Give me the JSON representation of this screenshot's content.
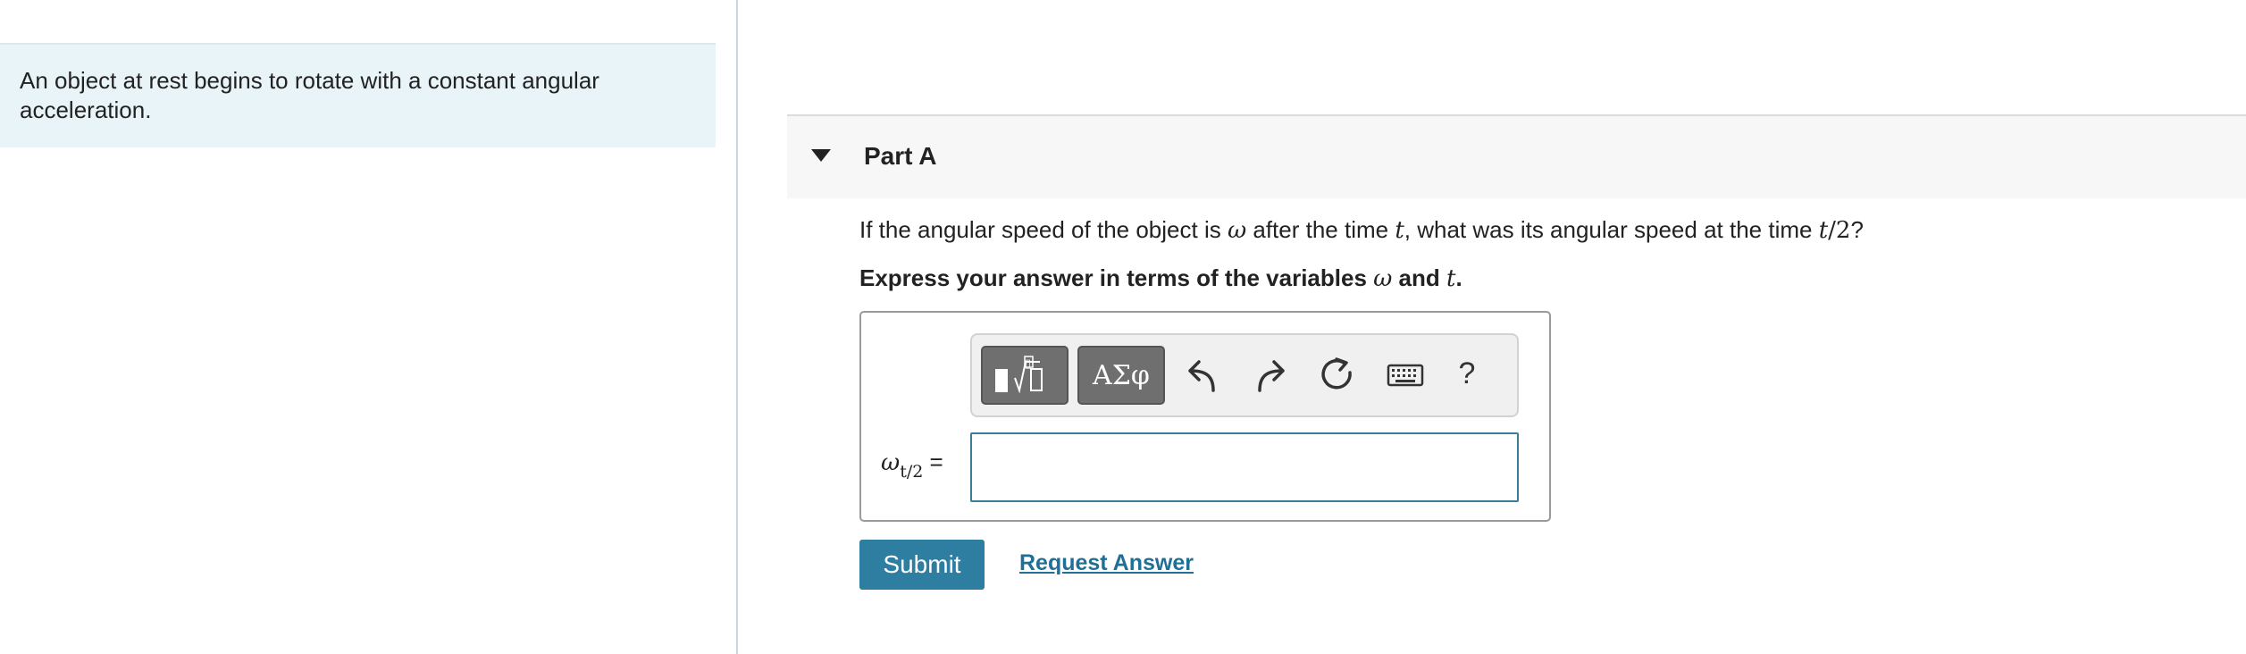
{
  "intro": {
    "text": "An object at rest begins to rotate with a constant angular acceleration."
  },
  "part": {
    "title": "Part A"
  },
  "question": {
    "prefix": "If the angular speed of the object is ",
    "omega": "ω",
    "middle1": " after the time ",
    "t": "t",
    "middle2": ", what was its angular speed at the time ",
    "t2_var": "t",
    "t2_rest": "/2",
    "suffix": "?"
  },
  "instruction": {
    "prefix": "Express your answer in terms of the variables ",
    "omega": "ω",
    "and": " and ",
    "t": "t",
    "suffix": "."
  },
  "toolbar": {
    "templates_icon": "templates-icon",
    "symbols_label": "ΑΣφ",
    "undo_icon": "undo-icon",
    "redo_icon": "redo-icon",
    "reset_icon": "reset-icon",
    "keyboard_icon": "keyboard-icon",
    "help_label": "?"
  },
  "answer": {
    "var_symbol": "ω",
    "var_sub": "t/2",
    "equals": " =",
    "value": "",
    "placeholder": ""
  },
  "buttons": {
    "submit_label": "Submit",
    "request_answer_label": "Request Answer"
  },
  "colors": {
    "intro_bg": "#e8f4f7",
    "submit_bg": "#2e7ea1",
    "link": "#1f6f96",
    "input_border": "#3a7f97"
  }
}
